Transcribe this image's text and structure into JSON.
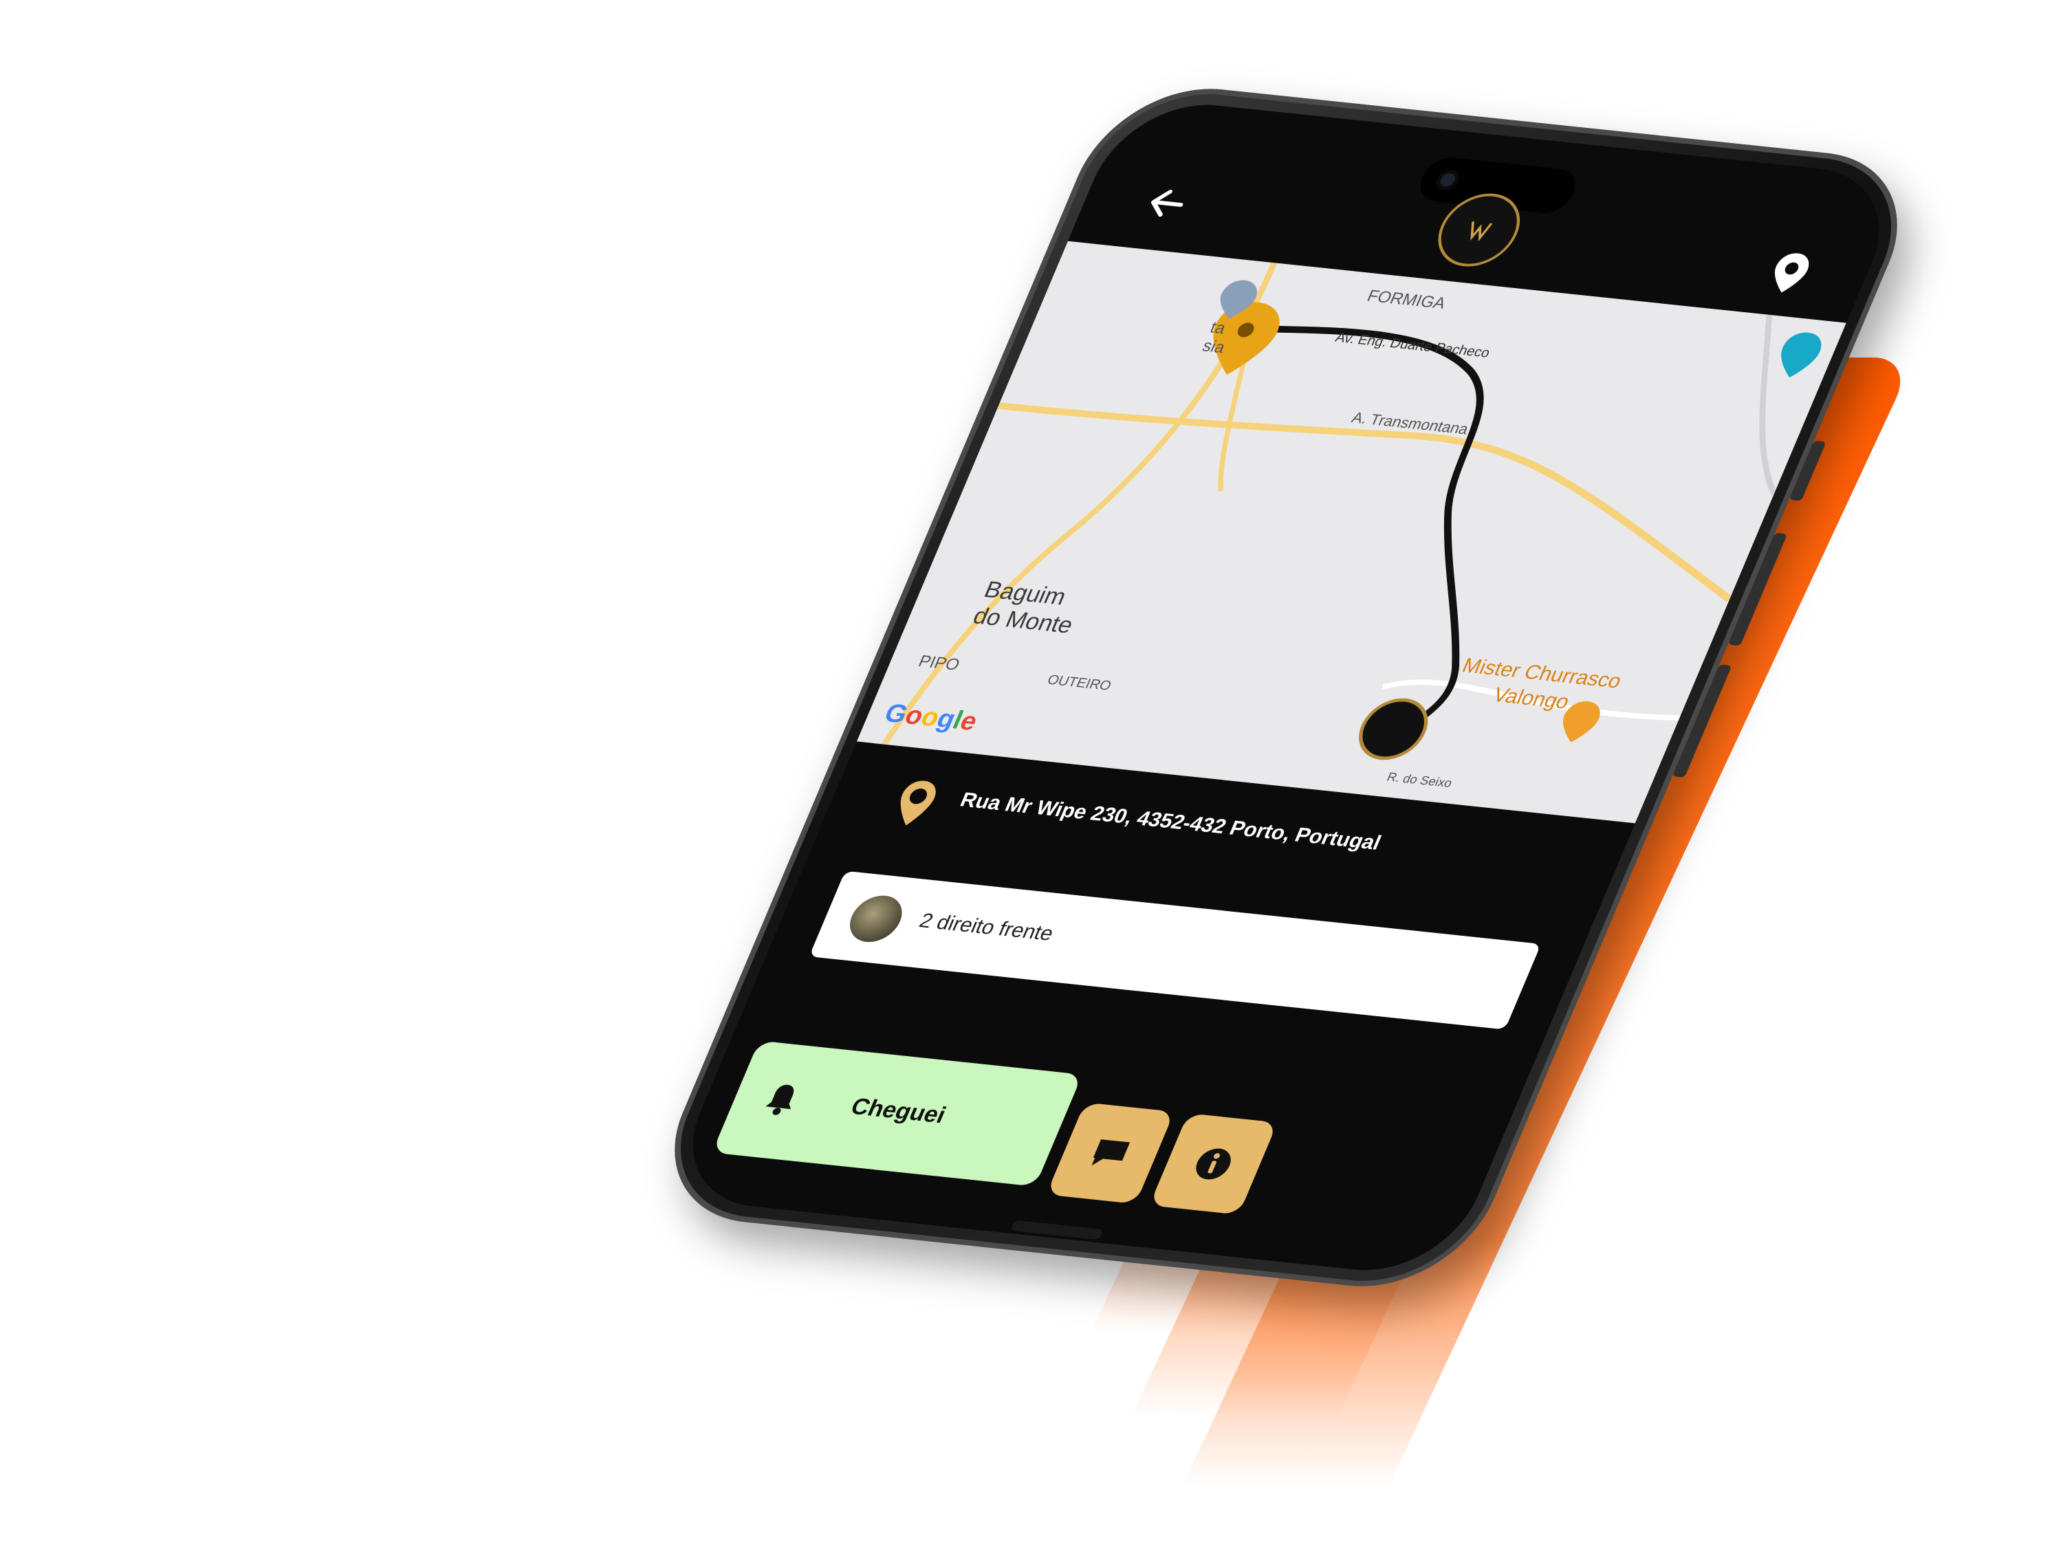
{
  "colors": {
    "accent_orange": "#ff5a00",
    "button_green": "#c9f7bd",
    "button_gold": "#e6b96b",
    "pin_gold": "#e8a317"
  },
  "header": {
    "back_icon": "back-arrow-icon",
    "location_icon": "location-pin-icon"
  },
  "map": {
    "labels": {
      "formiga": "FORMIGA",
      "street_eng": "Av. Eng. Duarte Pacheco",
      "transmontana": "A. Transmontana",
      "baguim": "Baguim",
      "do_monte": "do Monte",
      "restaurant_1": "Mister Churrasco",
      "restaurant_2": "Valongo",
      "pipo": "PIPO",
      "outeiro": "OUTEIRO",
      "seixo": "R. do Seixo",
      "partial_1": "ta",
      "partial_2": "sia"
    },
    "attribution": [
      "G",
      "o",
      "o",
      "g",
      "l",
      "e"
    ]
  },
  "address": {
    "text": "Rua Mr Wipe 230, 4352-432 Porto, Portugal"
  },
  "note": {
    "text": "2 direito frente"
  },
  "actions": {
    "arrived_label": "Cheguei"
  }
}
